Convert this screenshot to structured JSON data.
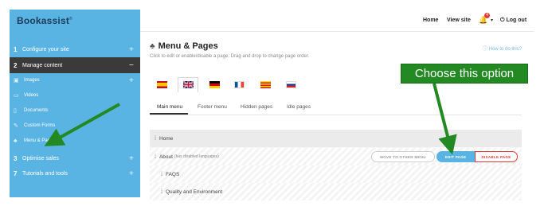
{
  "brand": {
    "name": "Bookassist",
    "mark": "®"
  },
  "sidebar": {
    "items": [
      {
        "num": "1",
        "label": "Configure your site",
        "toggle": "+"
      },
      {
        "num": "2",
        "label": "Manage content",
        "toggle": "−"
      },
      {
        "num": "3",
        "label": "Optimise sales",
        "toggle": "+"
      },
      {
        "num": "7",
        "label": "Tutorials and tools",
        "toggle": "+"
      }
    ],
    "subitems": [
      {
        "label": "Images",
        "icon": "image-icon",
        "toggle": "+"
      },
      {
        "label": "Videos",
        "icon": "video-icon"
      },
      {
        "label": "Documents",
        "icon": "document-icon"
      },
      {
        "label": "Custom Forms",
        "icon": "form-icon"
      },
      {
        "label": "Menu & Pages",
        "icon": "sitemap-icon"
      }
    ]
  },
  "header": {
    "home": "Home",
    "view_site": "View site",
    "notifications": "4",
    "logout": "Log out"
  },
  "main": {
    "title": "Menu & Pages",
    "subtitle": "Click to edit or enable/disable a page. Drag and drop to change page order.",
    "howto": "How to do this?",
    "languages": [
      "Spanish",
      "English",
      "German",
      "French",
      "Catalan",
      "Russian"
    ],
    "selected_language": "English",
    "tabs": [
      "Main menu",
      "Footer menu",
      "Hidden pages",
      "Idle pages"
    ],
    "rows": [
      {
        "label": "Home",
        "note": ""
      },
      {
        "label": "About",
        "note": "(has disabled languages)"
      },
      {
        "label": "FAQS",
        "note": ""
      },
      {
        "label": "Quality and Environment",
        "note": ""
      }
    ],
    "buttons": {
      "move": "MOVE TO OTHER MENU",
      "edit": "EDIT PAGE",
      "disable": "DISABLE PAGE"
    }
  },
  "annotation": {
    "callout": "Choose this option",
    "color": "#238a23"
  },
  "colors": {
    "sidebar": "#5ab4e3",
    "active_nav": "#3a3a3a",
    "danger": "#e53935"
  }
}
